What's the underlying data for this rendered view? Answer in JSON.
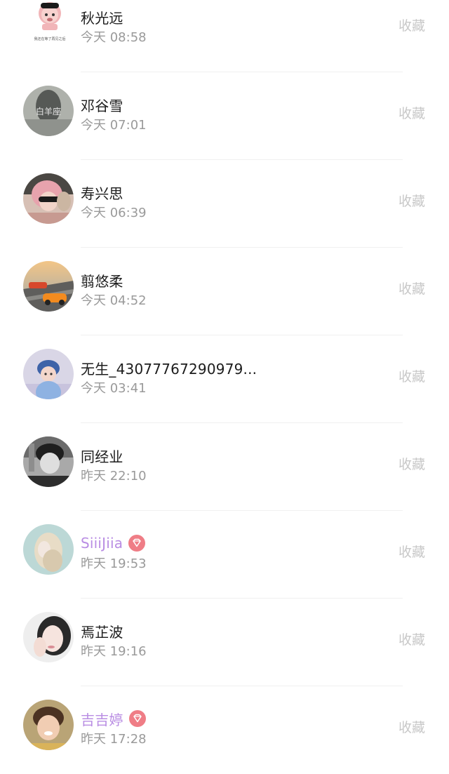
{
  "users": [
    {
      "name": "秋光远",
      "time": "今天 08:58",
      "action": "收藏",
      "vip": false
    },
    {
      "name": "邓谷雪",
      "time": "今天 07:01",
      "action": "收藏",
      "vip": false
    },
    {
      "name": "寿兴思",
      "time": "今天 06:39",
      "action": "收藏",
      "vip": false
    },
    {
      "name": "翦悠柔",
      "time": "今天 04:52",
      "action": "收藏",
      "vip": false
    },
    {
      "name": "无生_43077767290979...",
      "time": "今天 03:41",
      "action": "收藏",
      "vip": false
    },
    {
      "name": "同经业",
      "time": "昨天 22:10",
      "action": "收藏",
      "vip": false
    },
    {
      "name": "SiiiJiia",
      "time": "昨天 19:53",
      "action": "收藏",
      "vip": true
    },
    {
      "name": "焉芷波",
      "time": "昨天 19:16",
      "action": "收藏",
      "vip": false
    },
    {
      "name": "吉吉婷",
      "time": "昨天 17:28",
      "action": "收藏",
      "vip": true
    }
  ],
  "avatar_text": {
    "card_0": "我还在等了再见之后",
    "photo_1": "白羊座"
  },
  "colors": {
    "vip_name": "#b98de3",
    "vip_badge": "#ef7d86",
    "action_text": "#c8c8c8",
    "time_text": "#9a9a9a"
  },
  "icons": {
    "vip_badge": "diamond-icon"
  }
}
